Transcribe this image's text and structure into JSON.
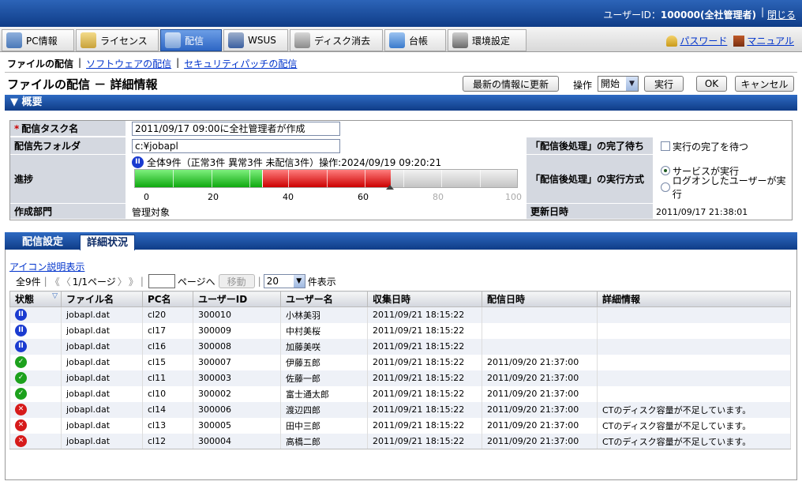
{
  "header": {
    "user_label": "ユーザーID：",
    "user_id": "100000(全社管理者)",
    "separator": "|",
    "logout": "閉じる"
  },
  "tabs": [
    {
      "label": "PC情報",
      "icon": "pc-icon",
      "color": "#4a78b8"
    },
    {
      "label": "ライセンス",
      "icon": "license-icon",
      "color": "#c9a23a"
    },
    {
      "label": "配信",
      "icon": "delivery-icon",
      "color": "#3b6fc0",
      "active": true
    },
    {
      "label": "WSUS",
      "icon": "wsus-icon",
      "color": "#3b5fa0"
    },
    {
      "label": "ディスク消去",
      "icon": "disk-erase-icon",
      "color": "#8a8a8a"
    },
    {
      "label": "台帳",
      "icon": "ledger-icon",
      "color": "#3a7acc"
    },
    {
      "label": "環境設定",
      "icon": "settings-icon",
      "color": "#6a6a6a"
    }
  ],
  "right_links": {
    "password": "パスワード",
    "manual": "マニュアル"
  },
  "subnav": {
    "current": "ファイルの配信",
    "sep": "|",
    "link1": "ソフトウェアの配信",
    "link2": "セキュリティパッチの配信"
  },
  "page": {
    "title": "ファイルの配信 － 詳細情報",
    "refresh": "最新の情報に更新",
    "op_label": "操作",
    "op_value": "開始",
    "execute": "実行",
    "ok": "OK",
    "cancel": "キャンセル"
  },
  "summary": {
    "section": "▼ 概要",
    "task_label": "配信タスク名",
    "task_value": "2011/09/17 09:00に全社管理者が作成",
    "folder_label": "配信先フォルダ",
    "folder_value": "c:¥jobapl",
    "progress_label": "進捗",
    "progress_text": "全体9件（正常3件 異常3件 未配信3件）操作:2024/09/19 09:20:21",
    "progress": {
      "normal_pct": 33.3,
      "error_pct": 33.3
    },
    "axis": [
      "0",
      "20",
      "40",
      "60",
      "80",
      "100"
    ],
    "dept_label": "作成部門",
    "dept_value": "管理対象",
    "wait_label": "「配信後処理」の完了待ち",
    "wait_value": "実行の完了を待つ",
    "method_label": "「配信後処理」の実行方式",
    "method_opt1": "サービスが実行",
    "method_opt2": "ログオンしたユーザーが実行",
    "updated_label": "更新日時",
    "updated_value": "2011/09/17 21:38:01"
  },
  "subtabs": {
    "settings": "配信設定",
    "details": "詳細状況"
  },
  "list": {
    "icon_legend": "アイコン説明表示",
    "total": "全9件",
    "nav_first": "《",
    "nav_prev": "〈",
    "page_info": "1/1ページ",
    "nav_next": "〉",
    "nav_last": "》",
    "goto_suffix": "ページへ",
    "move": "移動",
    "per_page": "20",
    "per_page_suffix": "件表示",
    "columns": [
      "状態",
      "ファイル名",
      "PC名",
      "ユーザーID",
      "ユーザー名",
      "収集日時",
      "配信日時",
      "詳細情報"
    ],
    "rows": [
      {
        "status": "pause",
        "file": "jobapl.dat",
        "pc": "cl20",
        "uid": "300010",
        "uname": "小林美羽",
        "collected": "2011/09/21 18:15:22",
        "delivered": "",
        "detail": ""
      },
      {
        "status": "pause",
        "file": "jobapl.dat",
        "pc": "cl17",
        "uid": "300009",
        "uname": "中村美桜",
        "collected": "2011/09/21 18:15:22",
        "delivered": "",
        "detail": ""
      },
      {
        "status": "pause",
        "file": "jobapl.dat",
        "pc": "cl16",
        "uid": "300008",
        "uname": "加藤美咲",
        "collected": "2011/09/21 18:15:22",
        "delivered": "",
        "detail": ""
      },
      {
        "status": "ok",
        "file": "jobapl.dat",
        "pc": "cl15",
        "uid": "300007",
        "uname": "伊藤五郎",
        "collected": "2011/09/21 18:15:22",
        "delivered": "2011/09/20 21:37:00",
        "detail": ""
      },
      {
        "status": "ok",
        "file": "jobapl.dat",
        "pc": "cl11",
        "uid": "300003",
        "uname": "佐藤一郎",
        "collected": "2011/09/21 18:15:22",
        "delivered": "2011/09/20 21:37:00",
        "detail": ""
      },
      {
        "status": "ok",
        "file": "jobapl.dat",
        "pc": "cl10",
        "uid": "300002",
        "uname": "富士通太郎",
        "collected": "2011/09/21 18:15:22",
        "delivered": "2011/09/20 21:37:00",
        "detail": ""
      },
      {
        "status": "err",
        "file": "jobapl.dat",
        "pc": "cl14",
        "uid": "300006",
        "uname": "渡辺四郎",
        "collected": "2011/09/21 18:15:22",
        "delivered": "2011/09/20 21:37:00",
        "detail": "CTのディスク容量が不足しています。"
      },
      {
        "status": "err",
        "file": "jobapl.dat",
        "pc": "cl13",
        "uid": "300005",
        "uname": "田中三郎",
        "collected": "2011/09/21 18:15:22",
        "delivered": "2011/09/20 21:37:00",
        "detail": "CTのディスク容量が不足しています。"
      },
      {
        "status": "err",
        "file": "jobapl.dat",
        "pc": "cl12",
        "uid": "300004",
        "uname": "高橋二郎",
        "collected": "2011/09/21 18:15:22",
        "delivered": "2011/09/20 21:37:00",
        "detail": "CTのディスク容量が不足しています。"
      }
    ]
  }
}
